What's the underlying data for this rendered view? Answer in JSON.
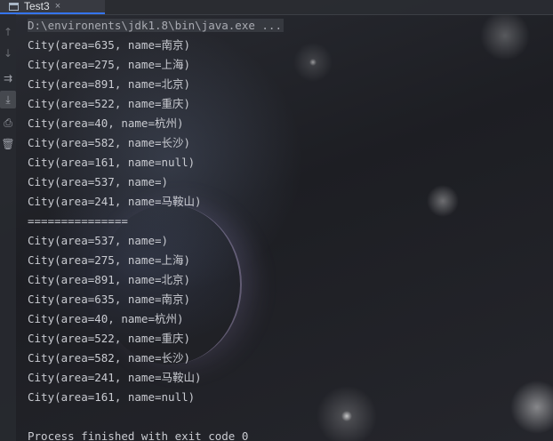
{
  "tab": {
    "title": "Test3",
    "close_glyph": "×"
  },
  "toolbar": {
    "items": [
      {
        "icon": "arrow-up-icon",
        "glyph": "↑"
      },
      {
        "icon": "arrow-down-icon",
        "glyph": "↓"
      },
      {
        "icon": "soft-wrap-icon",
        "glyph": "⇉"
      },
      {
        "icon": "scroll-to-end-icon",
        "glyph": "⤓"
      },
      {
        "icon": "print-icon",
        "glyph": "⎙"
      },
      {
        "icon": "trash-icon",
        "glyph": "🗑"
      }
    ]
  },
  "console": {
    "command": "D:\\environents\\jdk1.8\\bin\\java.exe ...",
    "lines": [
      "City(area=635, name=南京)",
      "City(area=275, name=上海)",
      "City(area=891, name=北京)",
      "City(area=522, name=重庆)",
      "City(area=40, name=杭州)",
      "City(area=582, name=长沙)",
      "City(area=161, name=null)",
      "City(area=537, name=)",
      "City(area=241, name=马鞍山)",
      "===============",
      "City(area=537, name=)",
      "City(area=275, name=上海)",
      "City(area=891, name=北京)",
      "City(area=635, name=南京)",
      "City(area=40, name=杭州)",
      "City(area=522, name=重庆)",
      "City(area=582, name=长沙)",
      "City(area=241, name=马鞍山)",
      "City(area=161, name=null)"
    ],
    "exit_message": "Process finished with exit code 0"
  }
}
